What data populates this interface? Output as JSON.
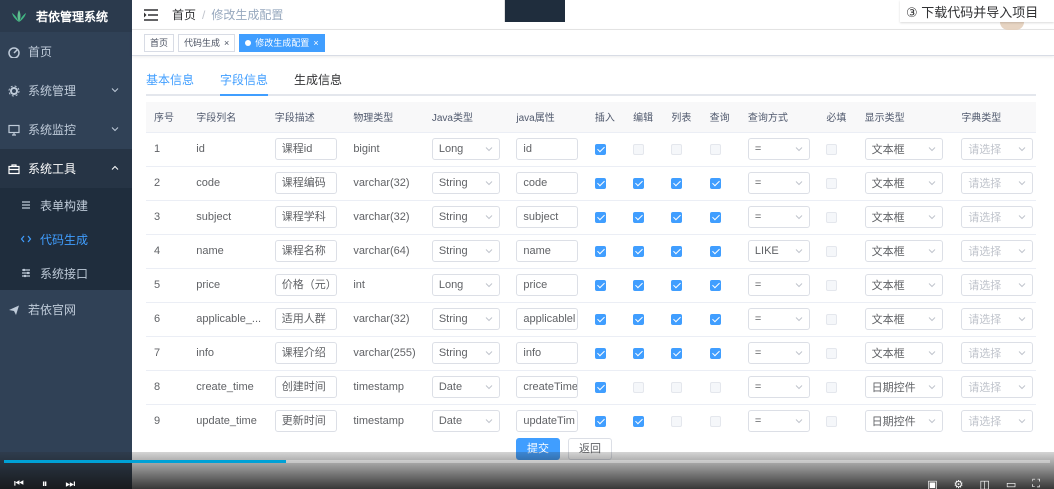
{
  "app": {
    "title": "若依管理系统"
  },
  "sidebar": {
    "items": [
      {
        "label": "首页",
        "icon": "dashboard-icon"
      },
      {
        "label": "系统管理",
        "icon": "gear-icon"
      },
      {
        "label": "系统监控",
        "icon": "monitor-icon"
      },
      {
        "label": "系统工具",
        "icon": "toolbox-icon"
      },
      {
        "label": "若依官网",
        "icon": "send-icon"
      }
    ],
    "sub_items": [
      {
        "label": "表单构建",
        "icon": "form-icon"
      },
      {
        "label": "代码生成",
        "icon": "code-icon"
      },
      {
        "label": "系统接口",
        "icon": "api-icon"
      }
    ]
  },
  "breadcrumb": {
    "home": "首页",
    "current": "修改生成配置"
  },
  "banner": {
    "step": "③ 下载代码并导入项目"
  },
  "tags": [
    {
      "label": "首页"
    },
    {
      "label": "代码生成"
    },
    {
      "label": "修改生成配置"
    }
  ],
  "tabs": [
    {
      "label": "基本信息"
    },
    {
      "label": "字段信息"
    },
    {
      "label": "生成信息"
    }
  ],
  "table": {
    "headers": [
      "序号",
      "字段列名",
      "字段描述",
      "物理类型",
      "Java类型",
      "java属性",
      "插入",
      "编辑",
      "列表",
      "查询",
      "查询方式",
      "必填",
      "显示类型",
      "字典类型"
    ],
    "rows": [
      {
        "no": "1",
        "column": "id",
        "desc": "课程id",
        "phys": "bigint",
        "jtype": "Long",
        "jprop": "id",
        "ins": true,
        "edit": false,
        "list": false,
        "query": false,
        "qmode": "=",
        "req": false,
        "show": "文本框",
        "dict": "请选择"
      },
      {
        "no": "2",
        "column": "code",
        "desc": "课程编码",
        "phys": "varchar(32)",
        "jtype": "String",
        "jprop": "code",
        "ins": true,
        "edit": true,
        "list": true,
        "query": true,
        "qmode": "=",
        "req": false,
        "show": "文本框",
        "dict": "请选择"
      },
      {
        "no": "3",
        "column": "subject",
        "desc": "课程学科",
        "phys": "varchar(32)",
        "jtype": "String",
        "jprop": "subject",
        "ins": true,
        "edit": true,
        "list": true,
        "query": true,
        "qmode": "=",
        "req": false,
        "show": "文本框",
        "dict": "请选择"
      },
      {
        "no": "4",
        "column": "name",
        "desc": "课程名称",
        "phys": "varchar(64)",
        "jtype": "String",
        "jprop": "name",
        "ins": true,
        "edit": true,
        "list": true,
        "query": true,
        "qmode": "LIKE",
        "req": false,
        "show": "文本框",
        "dict": "请选择"
      },
      {
        "no": "5",
        "column": "price",
        "desc": "价格（元）",
        "phys": "int",
        "jtype": "Long",
        "jprop": "price",
        "ins": true,
        "edit": true,
        "list": true,
        "query": true,
        "qmode": "=",
        "req": false,
        "show": "文本框",
        "dict": "请选择"
      },
      {
        "no": "6",
        "column": "applicable_...",
        "desc": "适用人群",
        "phys": "varchar(32)",
        "jtype": "String",
        "jprop": "applicablel",
        "ins": true,
        "edit": true,
        "list": true,
        "query": true,
        "qmode": "=",
        "req": false,
        "show": "文本框",
        "dict": "请选择"
      },
      {
        "no": "7",
        "column": "info",
        "desc": "课程介绍",
        "phys": "varchar(255)",
        "jtype": "String",
        "jprop": "info",
        "ins": true,
        "edit": true,
        "list": true,
        "query": true,
        "qmode": "=",
        "req": false,
        "show": "文本框",
        "dict": "请选择"
      },
      {
        "no": "8",
        "column": "create_time",
        "desc": "创建时间",
        "phys": "timestamp",
        "jtype": "Date",
        "jprop": "createTime",
        "ins": true,
        "edit": false,
        "list": false,
        "query": false,
        "qmode": "=",
        "req": false,
        "show": "日期控件",
        "dict": "请选择"
      },
      {
        "no": "9",
        "column": "update_time",
        "desc": "更新时间",
        "phys": "timestamp",
        "jtype": "Date",
        "jprop": "updateTim",
        "ins": true,
        "edit": true,
        "list": false,
        "query": false,
        "qmode": "=",
        "req": false,
        "show": "日期控件",
        "dict": "请选择"
      }
    ]
  },
  "buttons": {
    "submit": "提交",
    "back": "返回"
  },
  "player": {
    "progress_fraction": 0.27
  },
  "colors": {
    "accent": "#409eff",
    "sidebar": "#304156",
    "progress": "#00a1d6"
  }
}
